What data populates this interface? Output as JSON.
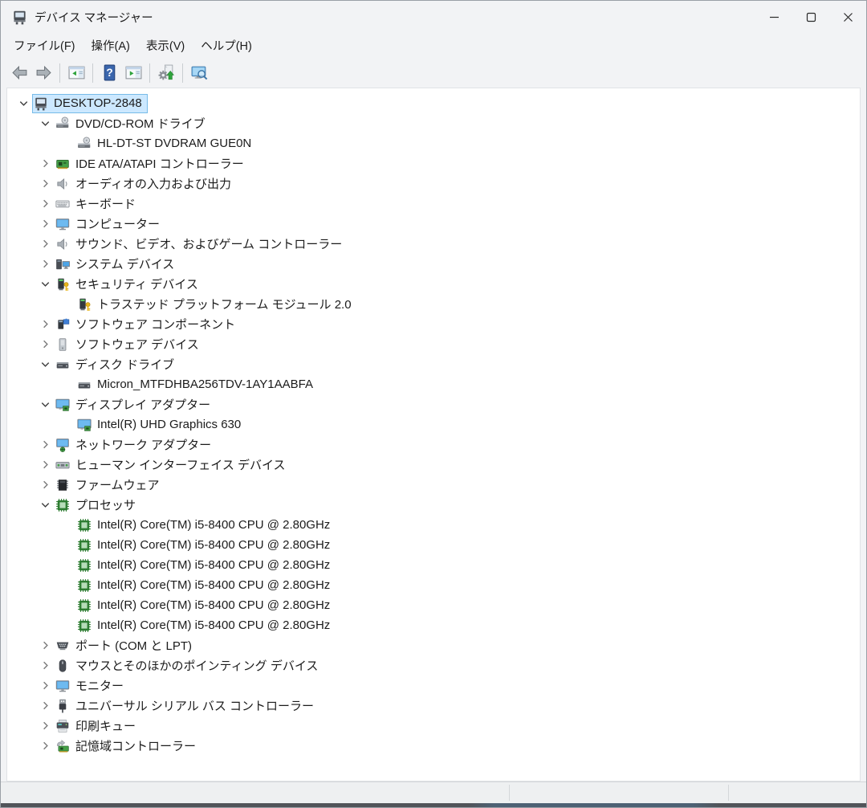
{
  "window": {
    "title": "デバイス マネージャー",
    "controls": [
      "minimize",
      "maximize",
      "close"
    ]
  },
  "menu": {
    "items": [
      {
        "label": "ファイル(F)"
      },
      {
        "label": "操作(A)"
      },
      {
        "label": "表示(V)"
      },
      {
        "label": "ヘルプ(H)"
      }
    ]
  },
  "toolbar": {
    "buttons": [
      "back",
      "forward",
      "console-tree",
      "help",
      "properties",
      "scan-hardware-changes",
      "computer-search"
    ]
  },
  "colors": {
    "selection_bg": "#cce8ff",
    "selection_border": "#77bbe8",
    "chrome_bg": "#f2f3f5",
    "tree_bg": "#ffffff",
    "ide_green": "#44a047",
    "monitor_blue": "#4da5e8",
    "key_yellow": "#e8b51c"
  },
  "tree": {
    "items": [
      {
        "level": 0,
        "state": "expanded",
        "icon": "computer",
        "label": "DESKTOP-2848",
        "selected": true
      },
      {
        "level": 1,
        "state": "expanded",
        "icon": "disc-drive",
        "label": "DVD/CD-ROM ドライブ"
      },
      {
        "level": 2,
        "state": "leaf",
        "icon": "disc-drive",
        "label": "HL-DT-ST DVDRAM GUE0N"
      },
      {
        "level": 1,
        "state": "collapsed",
        "icon": "ide-controller",
        "label": "IDE ATA/ATAPI コントローラー"
      },
      {
        "level": 1,
        "state": "collapsed",
        "icon": "audio",
        "label": "オーディオの入力および出力"
      },
      {
        "level": 1,
        "state": "collapsed",
        "icon": "keyboard",
        "label": "キーボード"
      },
      {
        "level": 1,
        "state": "collapsed",
        "icon": "monitor",
        "label": "コンピューター"
      },
      {
        "level": 1,
        "state": "collapsed",
        "icon": "audio",
        "label": "サウンド、ビデオ、およびゲーム コントローラー"
      },
      {
        "level": 1,
        "state": "collapsed",
        "icon": "system-devices",
        "label": "システム デバイス"
      },
      {
        "level": 1,
        "state": "expanded",
        "icon": "security-device",
        "label": "セキュリティ デバイス"
      },
      {
        "level": 2,
        "state": "leaf",
        "icon": "security-device",
        "label": "トラステッド プラットフォーム モジュール 2.0"
      },
      {
        "level": 1,
        "state": "collapsed",
        "icon": "software-component",
        "label": "ソフトウェア コンポーネント"
      },
      {
        "level": 1,
        "state": "collapsed",
        "icon": "software-device",
        "label": "ソフトウェア デバイス"
      },
      {
        "level": 1,
        "state": "expanded",
        "icon": "disk-drive",
        "label": "ディスク ドライブ"
      },
      {
        "level": 2,
        "state": "leaf",
        "icon": "disk-drive",
        "label": "Micron_MTFDHBA256TDV-1AY1AABFA"
      },
      {
        "level": 1,
        "state": "expanded",
        "icon": "display-adapter",
        "label": "ディスプレイ アダプター"
      },
      {
        "level": 2,
        "state": "leaf",
        "icon": "display-adapter",
        "label": "Intel(R) UHD Graphics 630"
      },
      {
        "level": 1,
        "state": "collapsed",
        "icon": "network-adapter",
        "label": "ネットワーク アダプター"
      },
      {
        "level": 1,
        "state": "collapsed",
        "icon": "hid",
        "label": "ヒューマン インターフェイス デバイス"
      },
      {
        "level": 1,
        "state": "collapsed",
        "icon": "firmware",
        "label": "ファームウェア"
      },
      {
        "level": 1,
        "state": "expanded",
        "icon": "processor",
        "label": "プロセッサ"
      },
      {
        "level": 2,
        "state": "leaf",
        "icon": "processor",
        "label": "Intel(R) Core(TM) i5-8400 CPU @ 2.80GHz"
      },
      {
        "level": 2,
        "state": "leaf",
        "icon": "processor",
        "label": "Intel(R) Core(TM) i5-8400 CPU @ 2.80GHz"
      },
      {
        "level": 2,
        "state": "leaf",
        "icon": "processor",
        "label": "Intel(R) Core(TM) i5-8400 CPU @ 2.80GHz"
      },
      {
        "level": 2,
        "state": "leaf",
        "icon": "processor",
        "label": "Intel(R) Core(TM) i5-8400 CPU @ 2.80GHz"
      },
      {
        "level": 2,
        "state": "leaf",
        "icon": "processor",
        "label": "Intel(R) Core(TM) i5-8400 CPU @ 2.80GHz"
      },
      {
        "level": 2,
        "state": "leaf",
        "icon": "processor",
        "label": "Intel(R) Core(TM) i5-8400 CPU @ 2.80GHz"
      },
      {
        "level": 1,
        "state": "collapsed",
        "icon": "ports",
        "label": "ポート (COM と LPT)"
      },
      {
        "level": 1,
        "state": "collapsed",
        "icon": "mouse",
        "label": "マウスとそのほかのポインティング デバイス"
      },
      {
        "level": 1,
        "state": "collapsed",
        "icon": "monitor",
        "label": "モニター"
      },
      {
        "level": 1,
        "state": "collapsed",
        "icon": "usb",
        "label": "ユニバーサル シリアル バス コントローラー"
      },
      {
        "level": 1,
        "state": "collapsed",
        "icon": "print-queue",
        "label": "印刷キュー"
      },
      {
        "level": 1,
        "state": "collapsed",
        "icon": "storage-controller",
        "label": "記憶域コントローラー"
      }
    ]
  },
  "statusbar": {
    "sections": [
      "",
      "",
      ""
    ]
  }
}
